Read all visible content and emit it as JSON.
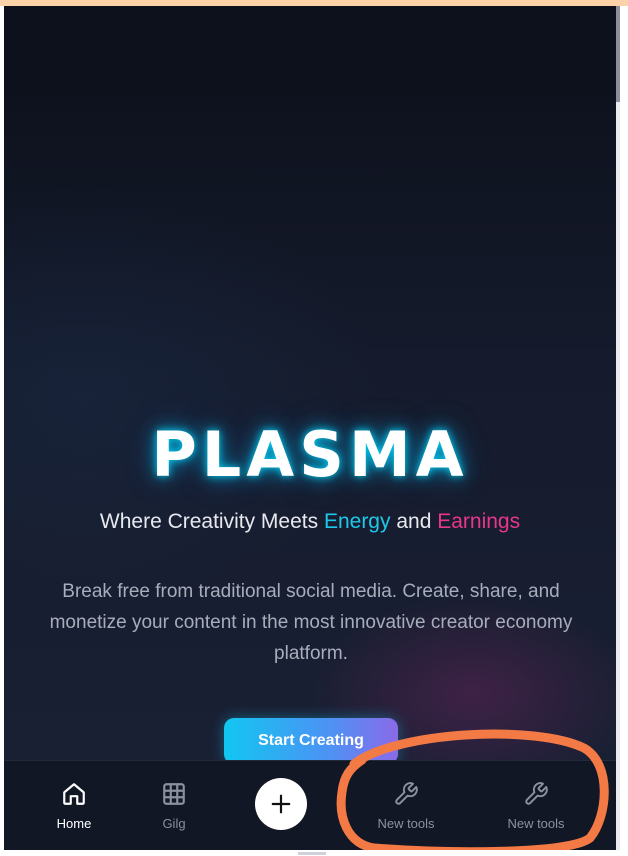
{
  "hero": {
    "logo_text": "PLASMA",
    "tagline": {
      "prefix": "Where Creativity Meets ",
      "highlight_1": "Energy",
      "middle": " and ",
      "highlight_2": "Earnings"
    },
    "description": "Break free from traditional social media. Create, share, and monetize your content in the most innovative creator economy platform.",
    "cta_label": "Start Creating"
  },
  "bottom_nav": {
    "items": [
      {
        "label": "Home",
        "icon": "home-icon",
        "active": true
      },
      {
        "label": "Gilg",
        "icon": "grid-icon",
        "active": false
      },
      {
        "label": "",
        "icon": "plus-icon",
        "active": false
      },
      {
        "label": "New tools",
        "icon": "wrench-icon",
        "active": false
      },
      {
        "label": "New tools",
        "icon": "wrench-icon",
        "active": false
      }
    ]
  },
  "colors": {
    "background": "#151a29",
    "energy_highlight": "#1ec8ea",
    "earnings_highlight": "#e8358d",
    "annotation_circle": "#f47a45"
  }
}
